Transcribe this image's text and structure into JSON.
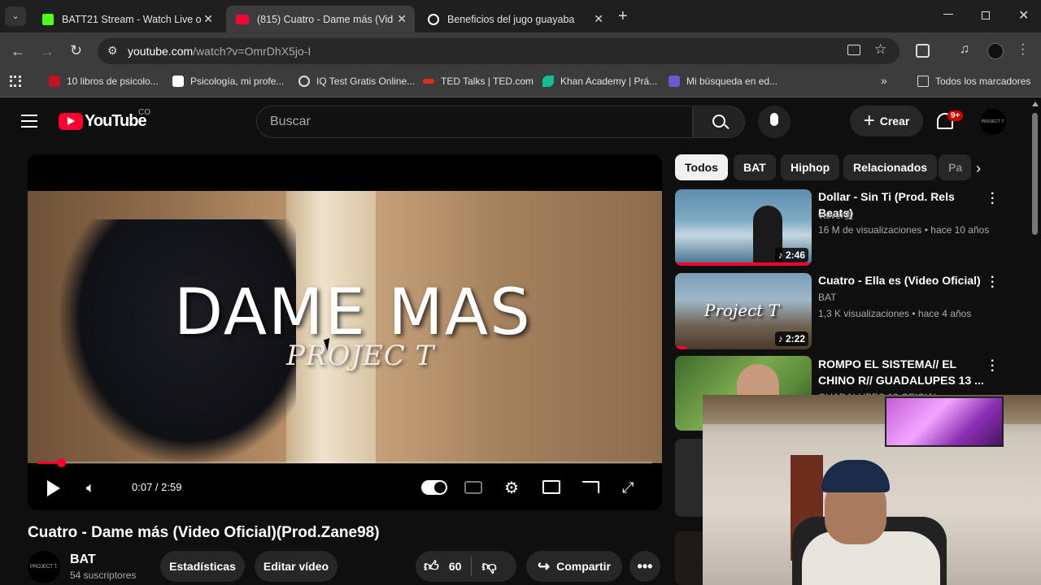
{
  "browser": {
    "tabs": [
      {
        "title": "BATT21 Stream - Watch Live o",
        "icon_color": "#53fc18"
      },
      {
        "title": "(815) Cuatro - Dame más (Video",
        "icon_color": "#ff0033"
      },
      {
        "title": "Beneficios del jugo guayaba",
        "icon_color": "#ffffff"
      }
    ],
    "url_domain": "youtube.com",
    "url_path": "/watch?v=OmrDhX5jo-I",
    "bookmarks": [
      "10 libros de psicolo...",
      "Psicología, mi profe...",
      "IQ Test Gratis Online...",
      "TED Talks | TED.com",
      "Khan Academy | Prá...",
      "Mi búsqueda en ed..."
    ],
    "bookmarks_folder": "Todos los marcadores"
  },
  "youtube": {
    "logo_text": "YouTube",
    "country": "CO",
    "search_placeholder": "Buscar",
    "create_label": "Crear",
    "notifications_badge": "9+",
    "avatar_text": "PROJECT T.",
    "chips": [
      "Todos",
      "BAT",
      "Hiphop",
      "Relacionados",
      "Pa"
    ]
  },
  "player": {
    "title_overlay": "DAME MAS",
    "subtitle_overlay": "PROJEC T",
    "time": "0:07 / 2:59",
    "progress": 0.039
  },
  "video": {
    "title": "Cuatro - Dame más (Video Oficial)(Prod.Zane98)",
    "channel": "BAT",
    "subscribers": "54 suscriptores",
    "stats_label": "Estadísticas",
    "edit_label": "Editar vídeo",
    "likes": "60",
    "share_label": "Compartir"
  },
  "recommended": [
    {
      "title": "Dollar - Sin Ti (Prod. Rels Beats)",
      "channel": "valver愛",
      "meta": "16 M de visualizaciones • hace 10 años",
      "duration": "2:46"
    },
    {
      "title": "Cuatro - Ella es  (Video Oficial)",
      "channel": "BAT",
      "meta": "1,3 K visualizaciones • hace 4 años",
      "duration": "2:22",
      "thumb_text": "Project T"
    },
    {
      "title": "ROMPO EL SISTEMA// EL CHINO R// GUADALUPES 13 ...",
      "channel": "GUADALUPES 13 OFICIAL",
      "meta": "",
      "duration": ""
    }
  ]
}
